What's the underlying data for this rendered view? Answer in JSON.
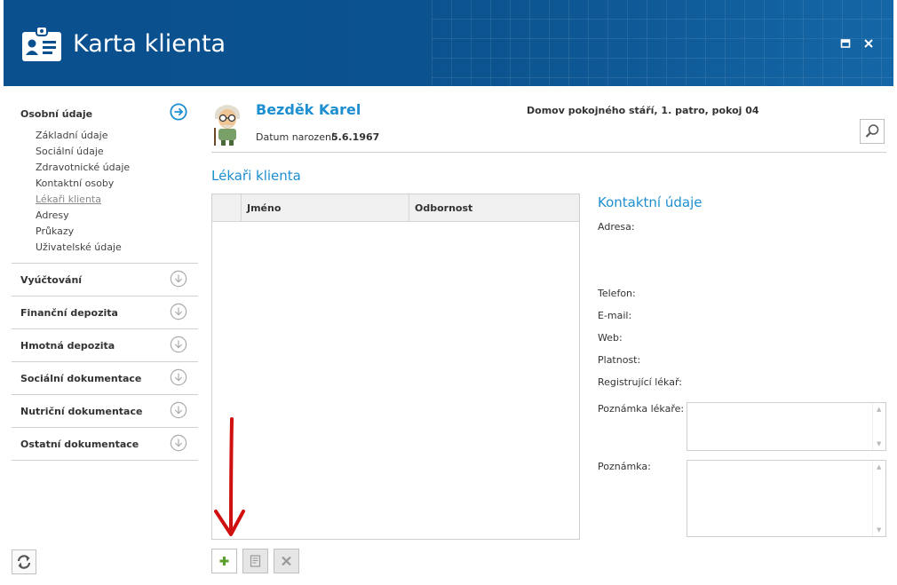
{
  "header": {
    "title": "Karta klienta",
    "icon": "id-card-icon"
  },
  "window": {
    "maximize_icon": "maximize-icon",
    "close_icon": "close-icon"
  },
  "sidebar": {
    "open_section": {
      "label": "Osobní údaje",
      "items": [
        {
          "label": "Základní údaje"
        },
        {
          "label": "Sociální údaje"
        },
        {
          "label": "Zdravotnické údaje"
        },
        {
          "label": "Kontaktní osoby"
        },
        {
          "label": "Lékaři klienta",
          "active": true
        },
        {
          "label": "Adresy"
        },
        {
          "label": "Průkazy"
        },
        {
          "label": "Uživatelské údaje"
        }
      ]
    },
    "sections": [
      {
        "label": "Vyúčtování"
      },
      {
        "label": "Finanční depozita"
      },
      {
        "label": "Hmotná depozita"
      },
      {
        "label": "Sociální dokumentace"
      },
      {
        "label": "Nutriční dokumentace"
      },
      {
        "label": "Ostatní dokumentace"
      }
    ]
  },
  "client": {
    "name": "Bezděk Karel",
    "dob_label": "Datum narození:",
    "dob_value": "5.6.1967",
    "location": "Domov pokojného stáří, 1. patro, pokoj 04"
  },
  "doctors": {
    "title": "Lékaři klienta",
    "columns": [
      "Jméno",
      "Odbornost"
    ],
    "rows": []
  },
  "contact": {
    "title": "Kontaktní údaje",
    "address_label": "Adresa:",
    "phone_label": "Telefon:",
    "email_label": "E-mail:",
    "web_label": "Web:",
    "validity_label": "Platnost:",
    "registering_label": "Registrující lékař:",
    "doctor_note_label": "Poznámka lékaře:",
    "note_label": "Poznámka:"
  },
  "colors": {
    "header": "#0a4f8e",
    "accent": "#1d8fd0",
    "add_icon": "#5aa02c",
    "arrow": "#d01010"
  }
}
